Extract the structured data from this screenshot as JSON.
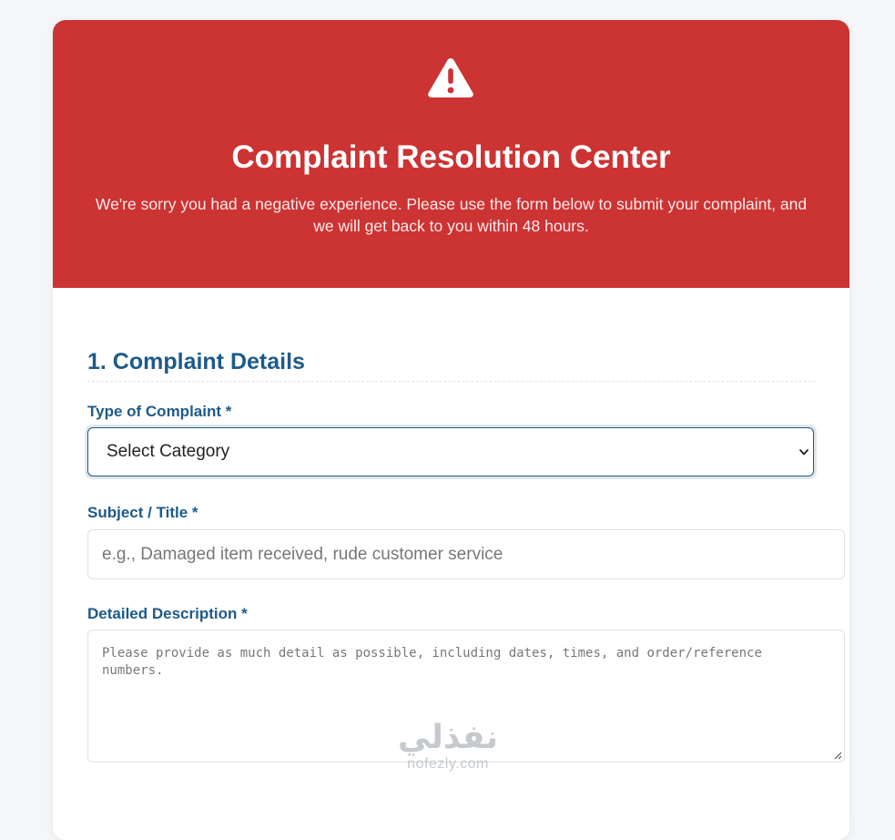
{
  "hero": {
    "icon": "warning-icon",
    "title": "Complaint Resolution Center",
    "subtitle": "We're sorry you had a negative experience. Please use the form below to submit your complaint, and we will get back to you within 48 hours."
  },
  "form": {
    "section_title": "1. Complaint Details",
    "type_field": {
      "label": "Type of Complaint *",
      "selected": "Select Category"
    },
    "subject_field": {
      "label": "Subject / Title *",
      "placeholder": "e.g., Damaged item received, rude customer service"
    },
    "description_field": {
      "label": "Detailed Description *",
      "placeholder": "Please provide as much detail as possible, including dates, times, and order/reference numbers."
    }
  },
  "watermark": {
    "logo": "نفذلي",
    "url": "nofezly.com"
  },
  "colors": {
    "hero_bg": "#cc3333",
    "label": "#1d5a8a",
    "page_bg": "#f4f6f8"
  }
}
